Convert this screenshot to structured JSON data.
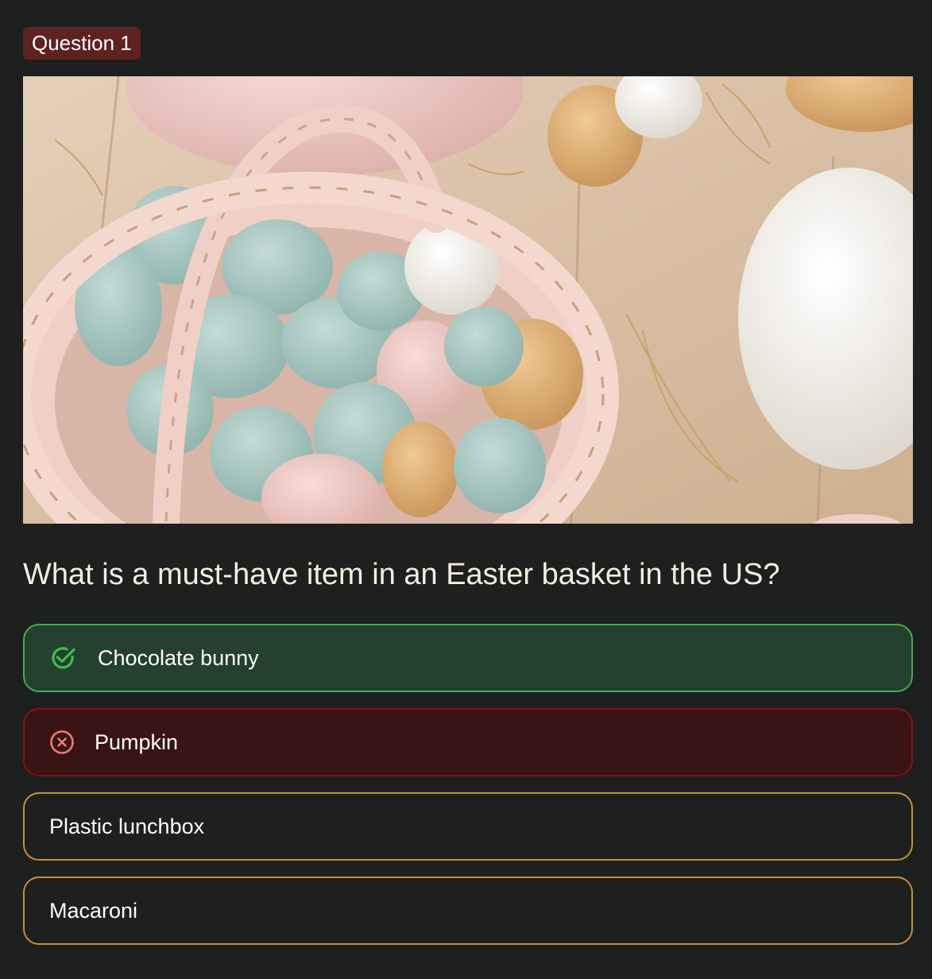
{
  "badge": {
    "label": "Question 1",
    "color": "#5e2220"
  },
  "image": {
    "alt": "Easter basket with pastel eggs",
    "icon": "easter-eggs-photo"
  },
  "question": {
    "text": "What is a must-have item in an Easter basket in the US?"
  },
  "options": [
    {
      "label": "Chocolate bunny",
      "state": "correct",
      "icon": "check-circle-icon",
      "color": "#3fae4f"
    },
    {
      "label": "Pumpkin",
      "state": "wrong",
      "icon": "x-circle-icon",
      "color": "#7c1410"
    },
    {
      "label": "Plastic lunchbox",
      "state": "unselected"
    },
    {
      "label": "Macaroni",
      "state": "unselected"
    }
  ],
  "colors": {
    "background": "#1e1f1f",
    "option_border": "#c2913a",
    "correct_bg": "#25402e",
    "wrong_bg": "#3a1414"
  }
}
